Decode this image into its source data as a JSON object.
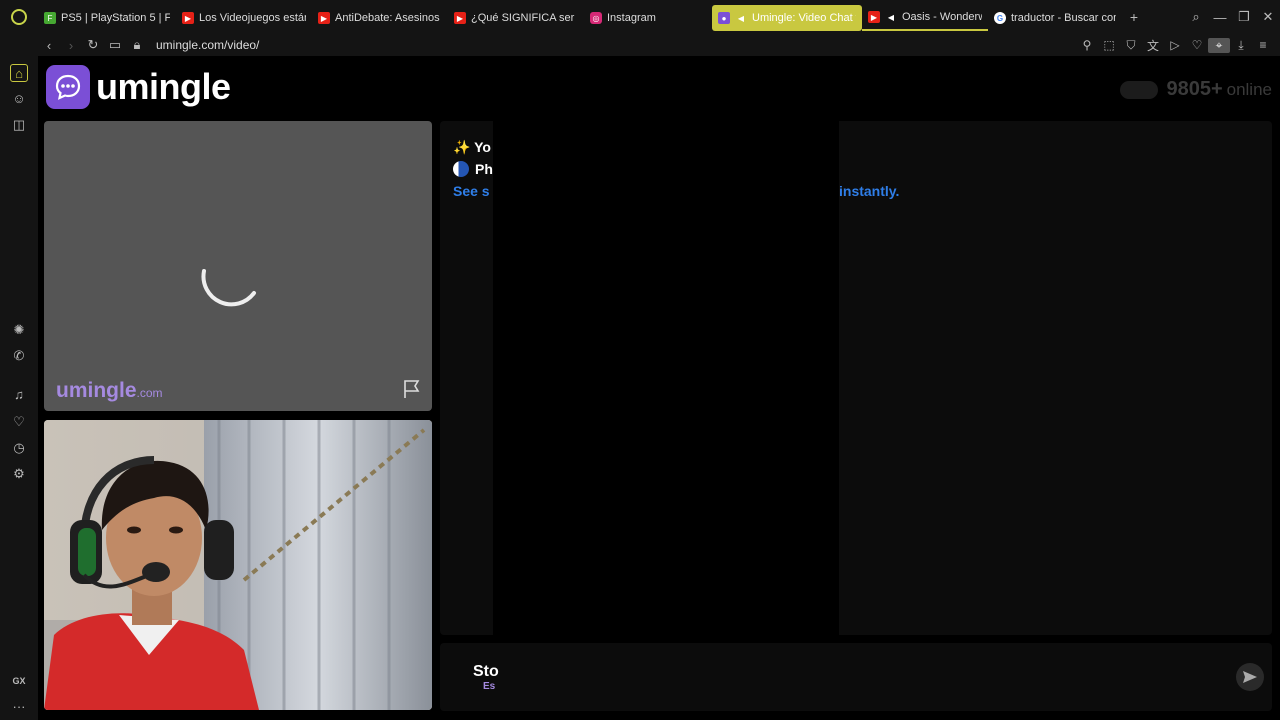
{
  "browser": {
    "tabs": [
      {
        "label": "PS5 | PlayStation 5 | F",
        "icon": "playstation-icon",
        "color": "#46a832"
      },
      {
        "label": "Los Videojuegos están",
        "icon": "youtube-icon",
        "color": "#e62117"
      },
      {
        "label": "AntiDebate: Asesinos",
        "icon": "youtube-icon",
        "color": "#e62117"
      },
      {
        "label": "¿Qué SIGNIFICA ser IN",
        "icon": "youtube-icon",
        "color": "#e62117"
      },
      {
        "label": "Instagram",
        "icon": "instagram-icon",
        "color": "#d62976"
      },
      {
        "label": "Umingle: Video Chat w",
        "icon": "umingle-icon",
        "color": "#7b4fd6",
        "active": true
      },
      {
        "label": "Oasis - Wonderwa",
        "icon": "youtube-icon",
        "color": "#e62117",
        "playing": true
      },
      {
        "label": "traductor - Buscar con",
        "icon": "google-icon",
        "color": "#4285f4"
      }
    ],
    "url": "umingle.com/video/",
    "accent": "#c9c840"
  },
  "sidebar": {
    "bottom_label": "GX",
    "more": "···"
  },
  "site": {
    "logo_text": "umingle",
    "brand_color": "#7b4fd6",
    "online_count": "9805+",
    "online_label": "online",
    "watermark_main": "umingle",
    "watermark_suffix": ".com"
  },
  "chat": {
    "line1_prefix": "✨",
    "line1_text": "Yo",
    "line2_text": "Ph",
    "line3_text": "See s",
    "line3_tail": "instantly.",
    "link_color": "#2f7ee8"
  },
  "controls": {
    "stop_label": "Sto",
    "stop_sub": "Es"
  }
}
